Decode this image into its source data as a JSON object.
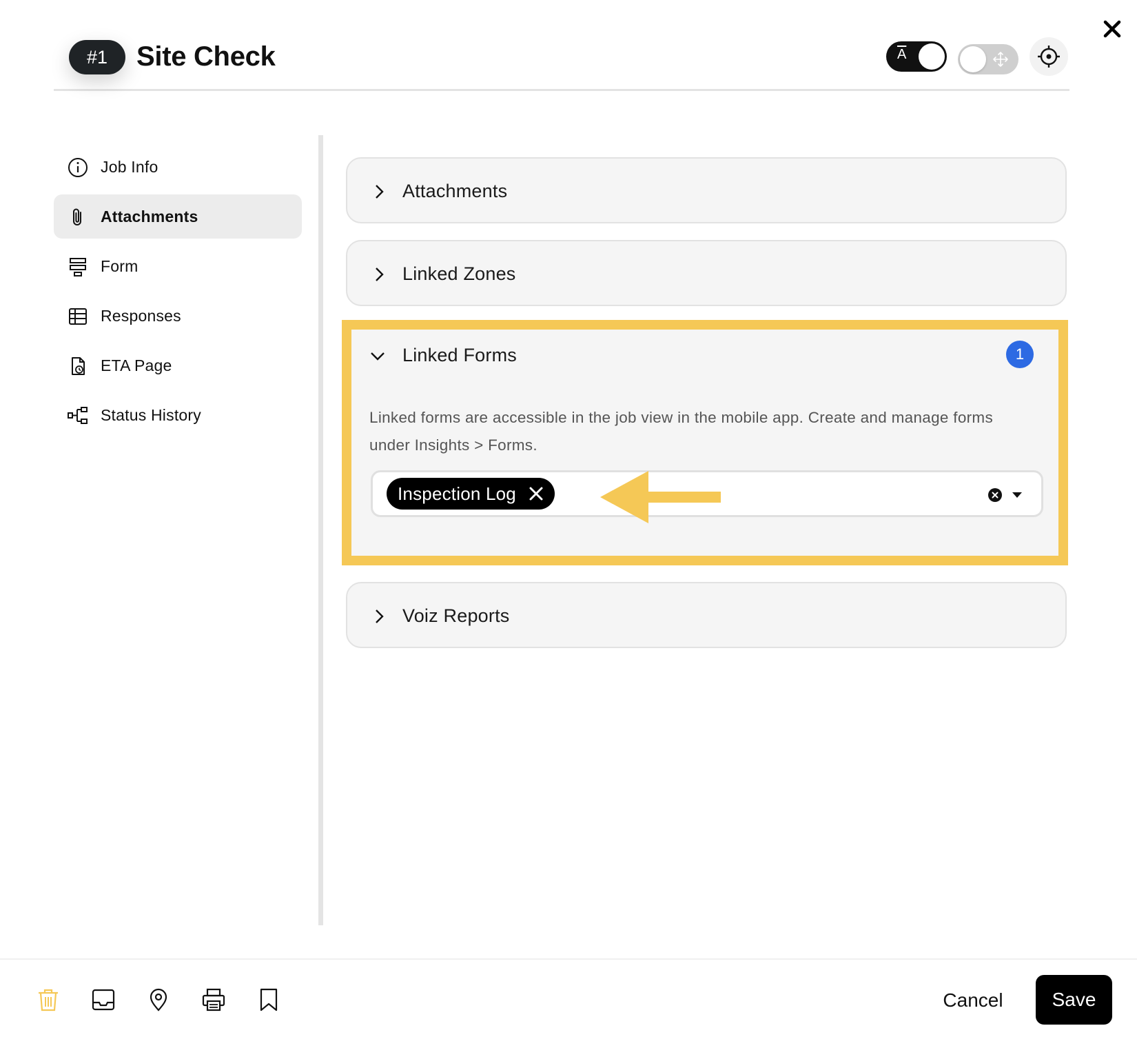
{
  "header": {
    "job_number": "#1",
    "title": "Site Check",
    "label_toggle_glyph": "A"
  },
  "sidebar": {
    "items": [
      {
        "label": "Job Info",
        "icon": "info-icon",
        "active": false
      },
      {
        "label": "Attachments",
        "icon": "paperclip-icon",
        "active": true
      },
      {
        "label": "Form",
        "icon": "form-icon",
        "active": false
      },
      {
        "label": "Responses",
        "icon": "table-icon",
        "active": false
      },
      {
        "label": "ETA Page",
        "icon": "document-clock-icon",
        "active": false
      },
      {
        "label": "Status History",
        "icon": "flow-icon",
        "active": false
      }
    ]
  },
  "sections": {
    "attachments": {
      "label": "Attachments"
    },
    "linked_zones": {
      "label": "Linked Zones"
    },
    "linked_forms": {
      "label": "Linked Forms",
      "count": "1",
      "description": "Linked forms are accessible in the job view in the mobile app. Create and manage forms under Insights > Forms.",
      "selected_forms": [
        "Inspection Log"
      ]
    },
    "voiz_reports": {
      "label": "Voiz Reports"
    }
  },
  "footer": {
    "tools": [
      "trash-icon",
      "inbox-icon",
      "map-pin-icon",
      "printer-icon",
      "bookmark-icon"
    ],
    "cancel_label": "Cancel",
    "save_label": "Save"
  },
  "colors": {
    "highlight": "#f5c856",
    "badge": "#2d6ae3",
    "trash": "#f5c856"
  }
}
